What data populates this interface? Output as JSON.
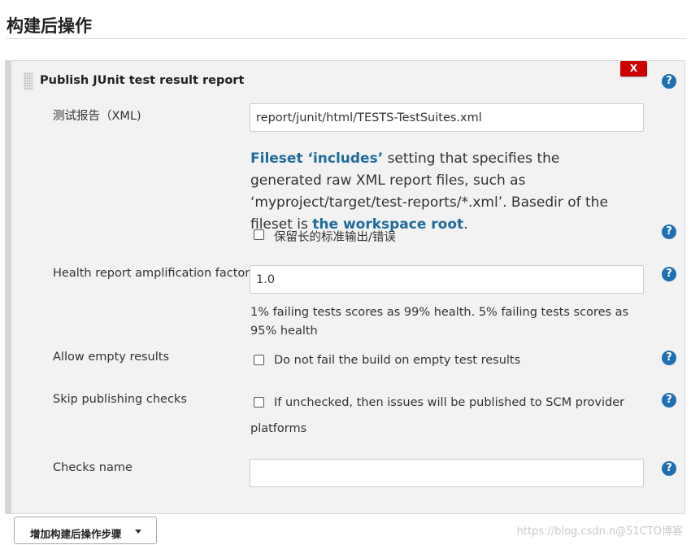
{
  "section": {
    "title": "构建后操作"
  },
  "step": {
    "heading": "Publish JUnit test result report",
    "delete_label": "X",
    "help_glyph": "?",
    "fields": {
      "test_report": {
        "label": "测试报告（XML)",
        "value": "report/junit/html/TESTS-TestSuites.xml",
        "description": {
          "link1": "Fileset ‘includes’",
          "text1": " setting that specifies the generated raw XML report files, such as ‘myproject/target/test-reports/*.xml’. Basedir of the fileset is ",
          "link2": "the workspace root",
          "text2": "."
        },
        "keep_output_label": "保留长的标准输出/错误"
      },
      "health_factor": {
        "label": "Health report amplification factor",
        "value": "1.0",
        "hint": "1% failing tests scores as 99% health. 5% failing tests scores as 95% health"
      },
      "allow_empty": {
        "label": "Allow empty results",
        "checkbox_label": "Do not fail the build on empty test results"
      },
      "skip_checks": {
        "label": "Skip publishing checks",
        "checkbox_label_line1": "If unchecked, then issues will be published to SCM provider",
        "checkbox_label_line2": "platforms"
      },
      "checks_name": {
        "label": "Checks name",
        "value": ""
      }
    }
  },
  "add_step_button": {
    "label": "增加构建后操作步骤"
  },
  "watermark": {
    "text": "https://blog.csdn.n@51CTO博客"
  },
  "icons": {
    "help": "help-icon",
    "caret": "caret-down-icon",
    "drag": "drag-handle-icon"
  },
  "colors": {
    "help_blue": "#1f6fb2",
    "delete_red": "#cc0000",
    "link_blue": "#1f6b9b",
    "panel_bg": "#f2f2f2"
  }
}
